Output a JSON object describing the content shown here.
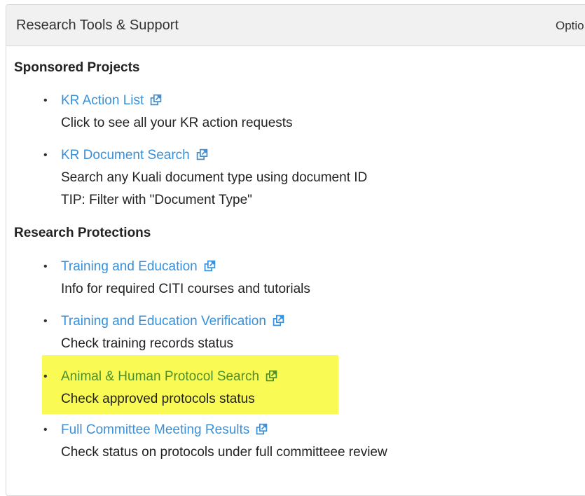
{
  "header": {
    "title": "Research Tools & Support",
    "options_label": "Optio"
  },
  "sections": [
    {
      "heading": "Sponsored Projects",
      "items": [
        {
          "link": "KR Action List",
          "desc": [
            "Click to see all your KR action requests"
          ]
        },
        {
          "link": "KR Document Search",
          "desc": [
            "Search any Kuali document type using document ID",
            "TIP: Filter with \"Document Type\""
          ]
        }
      ]
    },
    {
      "heading": "Research Protections",
      "items": [
        {
          "link": "Training and Education",
          "desc": [
            "Info for required CITI courses and tutorials"
          ]
        },
        {
          "link": "Training and Education Verification",
          "desc": [
            "Check training records status"
          ]
        },
        {
          "link": "Animal & Human Protocol Search",
          "desc": [
            "Check approved protocols status"
          ],
          "highlighted": true
        },
        {
          "link": "Full Committee Meeting Results",
          "desc": [
            "Check status on protocols under full committeee review"
          ]
        }
      ]
    }
  ],
  "colors": {
    "link": "#3a8fd6",
    "highlight": "#fafa54",
    "highlight_link": "#4d8f2a"
  },
  "icons": {
    "external": "external-link-icon",
    "bullet": "bullet"
  }
}
